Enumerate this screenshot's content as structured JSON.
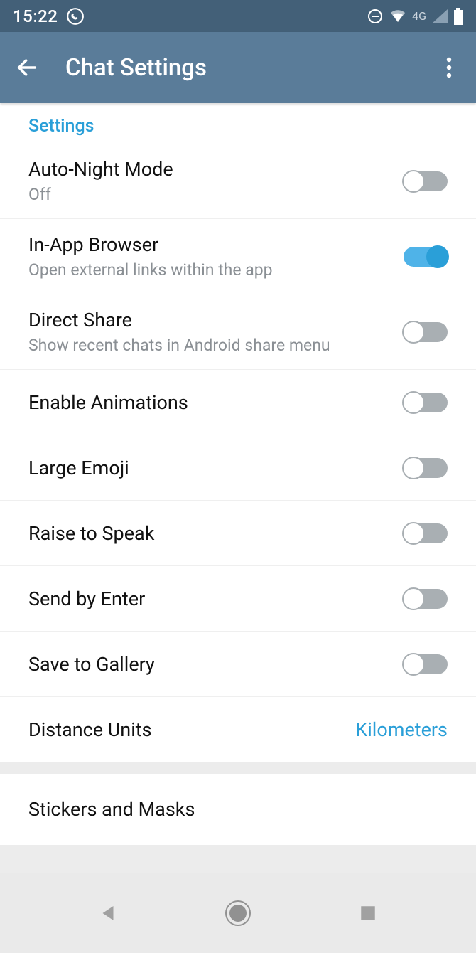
{
  "status": {
    "time": "15:22",
    "network": "4G"
  },
  "header": {
    "title": "Chat Settings"
  },
  "section_label": "Settings",
  "rows": {
    "auto_night": {
      "title": "Auto-Night Mode",
      "sub": "Off"
    },
    "in_app_browser": {
      "title": "In-App Browser",
      "sub": "Open external links within the app"
    },
    "direct_share": {
      "title": "Direct Share",
      "sub": "Show recent chats in Android share menu"
    },
    "enable_animations": {
      "title": "Enable Animations"
    },
    "large_emoji": {
      "title": "Large Emoji"
    },
    "raise_to_speak": {
      "title": "Raise to Speak"
    },
    "send_by_enter": {
      "title": "Send by Enter"
    },
    "save_to_gallery": {
      "title": "Save to Gallery"
    },
    "distance_units": {
      "title": "Distance Units",
      "value": "Kilometers"
    },
    "stickers_masks": {
      "title": "Stickers and Masks"
    }
  }
}
